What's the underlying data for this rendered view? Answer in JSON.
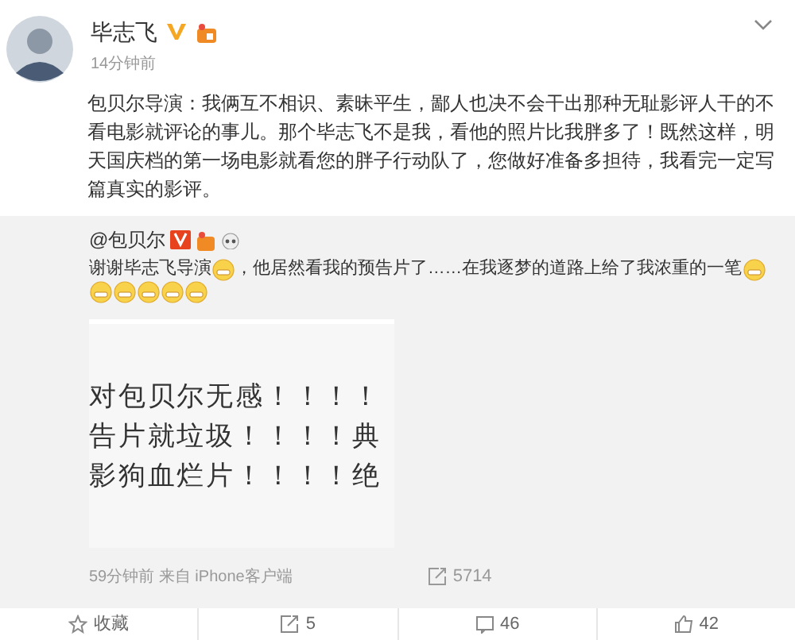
{
  "post": {
    "author": "毕志飞",
    "time": "14分钟前",
    "text": "包贝尔导演：我俩互不相识、素昧平生，鄙人也决不会干出那种无耻影评人干的不看电影就评论的事儿。那个毕志飞不是我，看他的照片比我胖多了！既然这样，明天国庆档的第一场电影就看您的胖子行动队了，您做好准备多担待，我看完一定写篇真实的影评。"
  },
  "repost": {
    "author": "@包贝尔",
    "segments": [
      {
        "kind": "text",
        "text": "谢谢毕志飞导演"
      },
      {
        "kind": "emoji"
      },
      {
        "kind": "text",
        "text": "，他居然看我的预告片了……在我逐梦的道路上给了我浓重的一笔"
      },
      {
        "kind": "emoji"
      },
      {
        "kind": "emoji"
      },
      {
        "kind": "emoji"
      },
      {
        "kind": "emoji"
      },
      {
        "kind": "emoji"
      },
      {
        "kind": "emoji"
      }
    ],
    "image_lines": [
      "对包贝尔无感！！！！",
      "告片就垃圾！！！！典",
      "影狗血烂片！！！！绝"
    ],
    "meta": "59分钟前 来自 iPhone客户端",
    "reposts": "5714"
  },
  "actions": [
    {
      "kind": "favorite",
      "label": "收藏"
    },
    {
      "kind": "repost",
      "label": "5"
    },
    {
      "kind": "comment",
      "label": "46"
    },
    {
      "kind": "like",
      "label": "42"
    }
  ]
}
